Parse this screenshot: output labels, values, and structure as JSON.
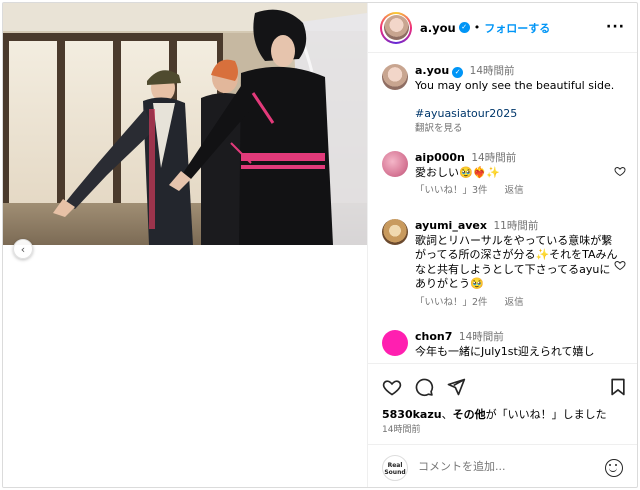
{
  "post": {
    "username": "a.you",
    "follow_label": "フォローする",
    "more_label": "···",
    "prev_label": "‹"
  },
  "caption": {
    "username": "a.you",
    "time": "14時間前",
    "text": "You may only see the beautiful side.",
    "hashtag": "#ayuasiatour2025",
    "translate": "翻訳を見る"
  },
  "comments": [
    {
      "username": "aip000n",
      "time": "14時間前",
      "text": "愛おしい🥹❤️‍🔥✨",
      "like_label": "「いいね！」3件",
      "reply_label": "返信"
    },
    {
      "username": "ayumi_avex",
      "time": "11時間前",
      "text": "歌詞とリハーサルをやっている意味が繋がってる所の深さが分る✨それをTAみんなと共有しようとして下さってるayuにありがとう🥹",
      "like_label": "「いいね！」2件",
      "reply_label": "返信"
    },
    {
      "username": "chon7",
      "time": "14時間前",
      "text": "今年も一緒にJuly1st迎えられて嬉し"
    }
  ],
  "actions": {
    "likes_user": "5830kazu",
    "likes_rest_1": "、",
    "likes_others": "その他",
    "likes_rest_2": "が「いいね！」しました",
    "timestamp": "14時間前"
  },
  "comment_box": {
    "placeholder": "コメントを追加...",
    "brand_logo": "Real Sound"
  },
  "colors": {
    "accent": "#0095f6",
    "muted": "#737373",
    "hashtag": "#00376b"
  }
}
